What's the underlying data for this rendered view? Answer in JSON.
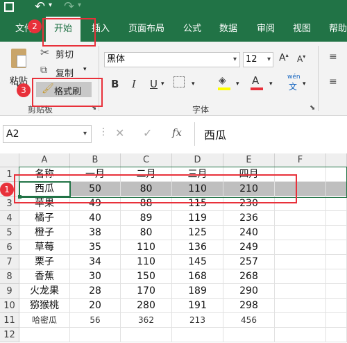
{
  "tabs": [
    "文件",
    "开始",
    "插入",
    "页面布局",
    "公式",
    "数据",
    "审阅",
    "视图",
    "帮助"
  ],
  "clipboard": {
    "paste": "粘贴",
    "cut": "剪切",
    "copy": "复制",
    "format_painter": "格式刷",
    "group": "剪贴板"
  },
  "font": {
    "name": "黑体",
    "size": "12",
    "group": "字体",
    "bold": "B",
    "italic": "I",
    "underline": "U",
    "wen": "wén",
    "wen_char": "文"
  },
  "formula_bar": {
    "namebox": "A2",
    "fx": "fx",
    "value": "西瓜"
  },
  "columns": [
    "A",
    "B",
    "C",
    "D",
    "E",
    "F"
  ],
  "rows": [
    [
      "名称",
      "一月",
      "二月",
      "三月",
      "四月"
    ],
    [
      "西瓜",
      "50",
      "80",
      "110",
      "210"
    ],
    [
      "苹果",
      "49",
      "88",
      "115",
      "230"
    ],
    [
      "橘子",
      "40",
      "89",
      "119",
      "236"
    ],
    [
      "橙子",
      "38",
      "80",
      "125",
      "240"
    ],
    [
      "草莓",
      "35",
      "110",
      "136",
      "249"
    ],
    [
      "栗子",
      "34",
      "110",
      "145",
      "257"
    ],
    [
      "香蕉",
      "30",
      "150",
      "168",
      "268"
    ],
    [
      "火龙果",
      "28",
      "170",
      "189",
      "290"
    ],
    [
      "猕猴桃",
      "20",
      "280",
      "191",
      "298"
    ],
    [
      "哈密瓜",
      "56",
      "362",
      "213",
      "456"
    ],
    [
      "",
      "",
      "",
      "",
      ""
    ]
  ],
  "row_numbers": [
    "1",
    "2",
    "3",
    "4",
    "5",
    "6",
    "7",
    "8",
    "9",
    "10",
    "11",
    "12"
  ],
  "badges": {
    "b1": "1",
    "b2": "2",
    "b3": "3"
  },
  "colors": {
    "excel_green": "#217346",
    "annotation_red": "#e8303a",
    "selection_gray": "#bfbfbf"
  }
}
